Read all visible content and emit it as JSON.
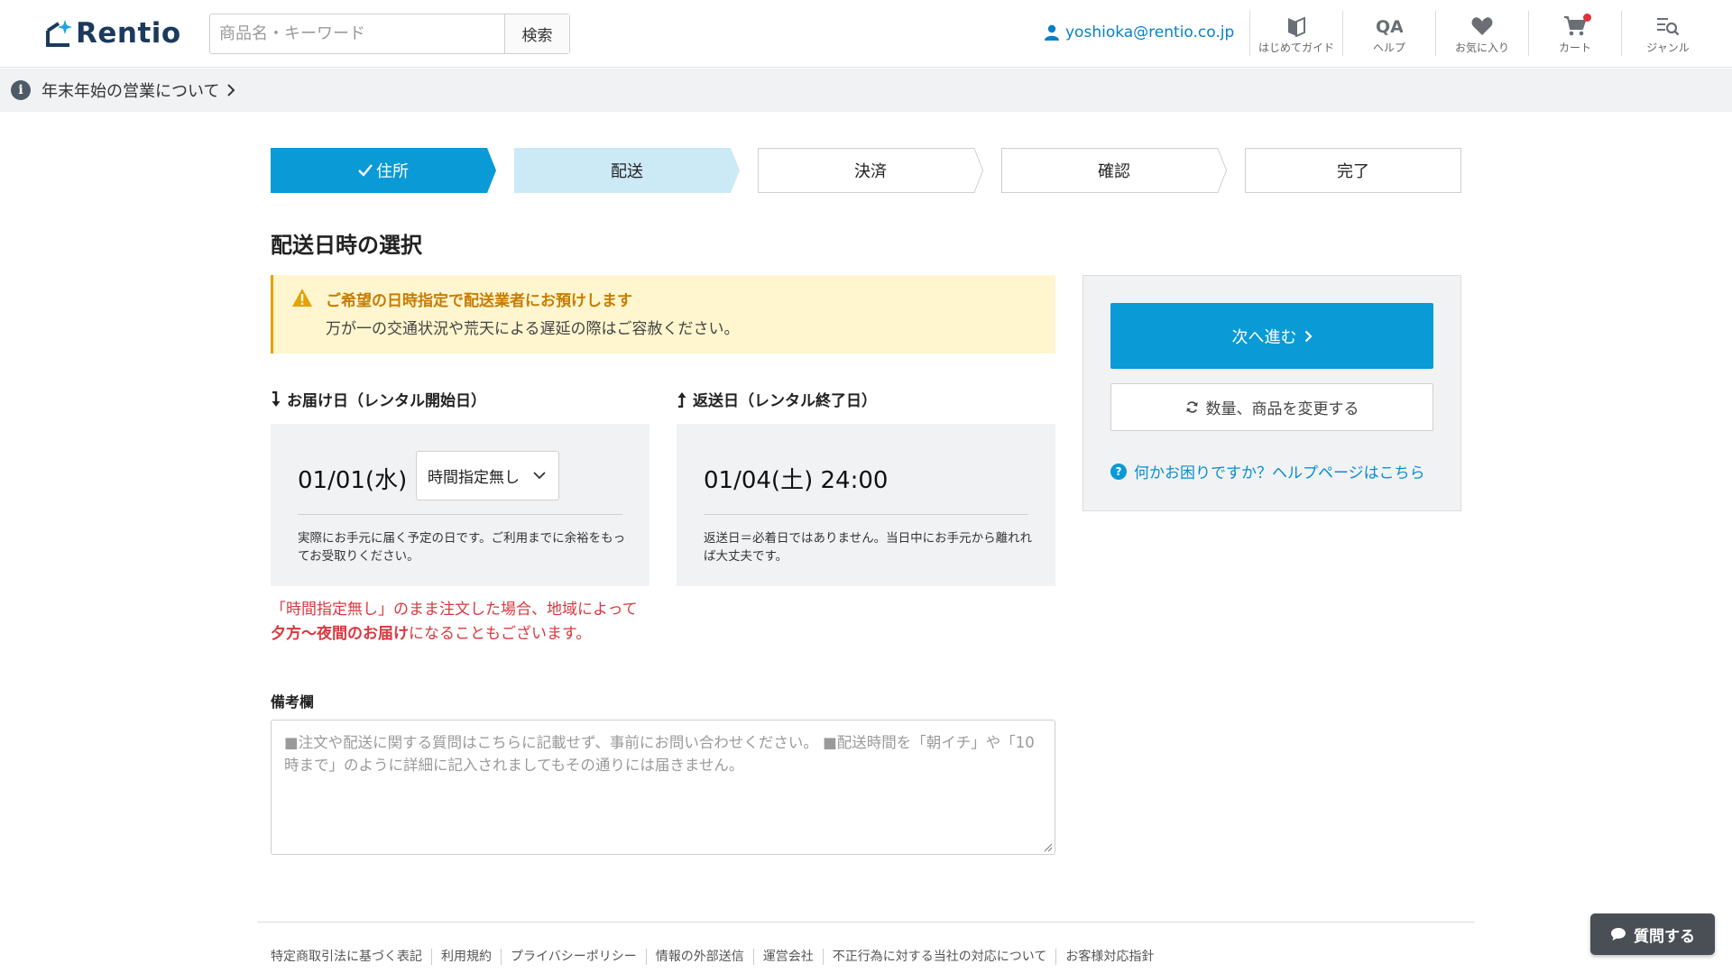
{
  "header": {
    "logo_text": "Rentio",
    "search": {
      "placeholder": "商品名・キーワード",
      "value": "",
      "button_label": "検索"
    },
    "user_email": "yoshioka@rentio.co.jp",
    "nav": [
      {
        "label": "はじめてガイド",
        "icon": "beginner-leaf-icon"
      },
      {
        "label": "ヘルプ",
        "icon": "qa-icon"
      },
      {
        "label": "お気に入り",
        "icon": "heart-icon"
      },
      {
        "label": "カート",
        "icon": "cart-icon"
      },
      {
        "label": "ジャンル",
        "icon": "genre-list-icon"
      }
    ]
  },
  "notice": {
    "text": "年末年始の営業について"
  },
  "steps": [
    {
      "label": "住所",
      "state": "done"
    },
    {
      "label": "配送",
      "state": "current"
    },
    {
      "label": "決済",
      "state": "todo"
    },
    {
      "label": "確認",
      "state": "todo"
    },
    {
      "label": "完了",
      "state": "todo"
    }
  ],
  "main": {
    "title": "配送日時の選択",
    "warning": {
      "title": "ご希望の日時指定で配送業者にお預けします",
      "body": "万が一の交通状況や荒天による遅延の際はご容赦ください。"
    },
    "delivery": {
      "heading": "お届け日（レンタル開始日）",
      "date": "01/01(水)",
      "time_select": "時間指定無し",
      "note": "実際にお手元に届く予定の日です。ご利用までに余裕をもってお受取りください。"
    },
    "return": {
      "heading": "返送日（レンタル終了日）",
      "date": "01/04(土)  24:00",
      "note": "返送日＝必着日ではありません。当日中にお手元から離れれば大丈夫です。"
    },
    "red_note": {
      "line1": "「時間指定無し」のまま注文した場合、地域によって",
      "bold": "夕方〜夜間のお届け",
      "rest": "になることもございます。"
    },
    "remarks": {
      "label": "備考欄",
      "placeholder": "■注文や配送に関する質問はこちらに記載せず、事前にお問い合わせください。 ■配送時間を「朝イチ」や「10時まで」のように詳細に記入されましてもその通りには届きません。",
      "value": ""
    }
  },
  "side": {
    "next_label": "次へ進む",
    "change_label": "数量、商品を変更する",
    "help_label": "何かお困りですか？ヘルプページはこちら"
  },
  "footer": {
    "links": [
      "特定商取引法に基づく表記",
      "利用規約",
      "プライバシーポリシー",
      "情報の外部送信",
      "運営会社",
      "不正行為に対する当社の対応について",
      "お客様対応指針"
    ]
  },
  "chat": {
    "label": "質問する"
  },
  "colors": {
    "primary": "#0a9ad6",
    "step_current": "#cce9f6",
    "warning_bg": "#fff6cf",
    "warning_text": "#c87c00",
    "alert_red": "#d8383f",
    "logo_navy": "#1b3a5c"
  }
}
